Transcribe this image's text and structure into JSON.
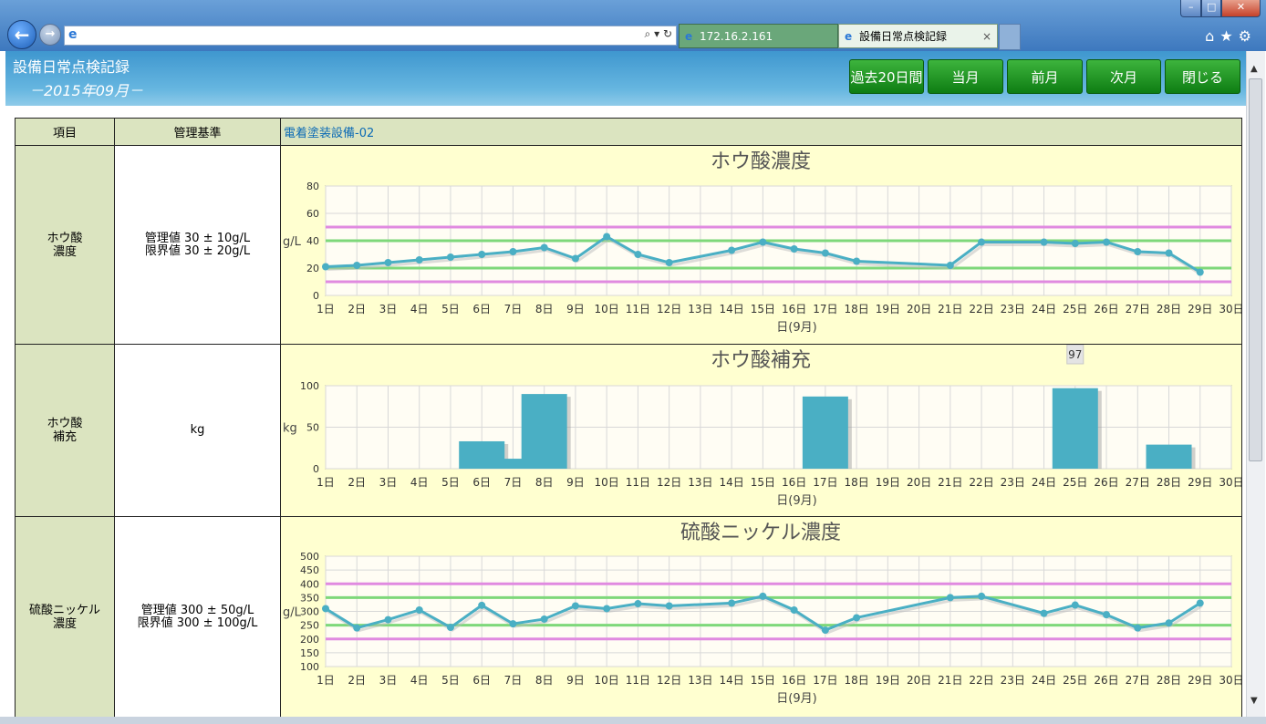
{
  "browser": {
    "tabs": [
      {
        "label": "172.16.2.161"
      },
      {
        "label": "設備日常点検記録"
      }
    ],
    "window_controls": {
      "minimize": "–",
      "maximize": "□",
      "close": "✕"
    }
  },
  "header": {
    "title": "設備日常点検記録",
    "month": "－2015年09月－",
    "buttons": [
      "過去20日間",
      "当月",
      "前月",
      "次月",
      "閉じる"
    ]
  },
  "table": {
    "columns": [
      "項目",
      "管理基準"
    ],
    "equipment": "電着塗装設備-02",
    "rows": [
      {
        "item": [
          "ホウ酸",
          "濃度"
        ],
        "standard": [
          "管理値  30 ± 10g/L",
          "限界値  30 ± 20g/L"
        ]
      },
      {
        "item": [
          "ホウ酸",
          "補充"
        ],
        "standard": [
          "kg"
        ]
      },
      {
        "item": [
          "硫酸ニッケル",
          "濃度"
        ],
        "standard": [
          "管理値  300 ± 50g/L",
          "限界値  300 ± 100g/L"
        ]
      }
    ]
  },
  "colors": {
    "line": "#4aafc4",
    "bar": "#4aafc4",
    "control_limit": "#7ed87a",
    "critical_limit": "#e08ae0",
    "plot_bg": "#fffdf4"
  },
  "chart_data": [
    {
      "type": "line",
      "title": "ホウ酸濃度",
      "ylabel": "g/L",
      "xlabel": "日(9月)",
      "x_ticks": [
        "1日",
        "2日",
        "3日",
        "4日",
        "5日",
        "6日",
        "7日",
        "8日",
        "9日",
        "10日",
        "11日",
        "12日",
        "13日",
        "14日",
        "15日",
        "16日",
        "17日",
        "18日",
        "19日",
        "20日",
        "21日",
        "22日",
        "23日",
        "24日",
        "25日",
        "26日",
        "27日",
        "28日",
        "29日",
        "30日"
      ],
      "ylim": [
        0,
        80
      ],
      "y_ticks": [
        0,
        20,
        40,
        60,
        80
      ],
      "points": [
        [
          1,
          21
        ],
        [
          2,
          22
        ],
        [
          3,
          24
        ],
        [
          4,
          26
        ],
        [
          5,
          28
        ],
        [
          6,
          30
        ],
        [
          7,
          32
        ],
        [
          8,
          35
        ],
        [
          9,
          27
        ],
        [
          10,
          43
        ],
        [
          11,
          30
        ],
        [
          12,
          24
        ],
        [
          14,
          33
        ],
        [
          15,
          39
        ],
        [
          16,
          34
        ],
        [
          17,
          31
        ],
        [
          18,
          25
        ],
        [
          21,
          22
        ],
        [
          22,
          39
        ],
        [
          24,
          39
        ],
        [
          25,
          38
        ],
        [
          26,
          39
        ],
        [
          27,
          32
        ],
        [
          28,
          31
        ],
        [
          29,
          17
        ]
      ],
      "reference_lines": [
        {
          "value": 20,
          "kind": "control"
        },
        {
          "value": 40,
          "kind": "control"
        },
        {
          "value": 10,
          "kind": "critical"
        },
        {
          "value": 50,
          "kind": "critical"
        }
      ]
    },
    {
      "type": "bar",
      "title": "ホウ酸補充",
      "ylabel": "kg",
      "xlabel": "日(9月)",
      "x_ticks": [
        "1日",
        "2日",
        "3日",
        "4日",
        "5日",
        "6日",
        "7日",
        "8日",
        "9日",
        "10日",
        "11日",
        "12日",
        "13日",
        "14日",
        "15日",
        "16日",
        "17日",
        "18日",
        "19日",
        "20日",
        "21日",
        "22日",
        "23日",
        "24日",
        "25日",
        "26日",
        "27日",
        "28日",
        "29日",
        "30日"
      ],
      "ylim": [
        0,
        100
      ],
      "y_ticks": [
        0,
        50,
        100
      ],
      "bars": [
        [
          6,
          33
        ],
        [
          7,
          12
        ],
        [
          8,
          90
        ],
        [
          17,
          87
        ],
        [
          25,
          97
        ],
        [
          28,
          29
        ]
      ],
      "tooltip": {
        "day": 25,
        "value": "97"
      }
    },
    {
      "type": "line",
      "title": "硫酸ニッケル濃度",
      "ylabel": "g/L",
      "xlabel": "日(9月)",
      "x_ticks": [
        "1日",
        "2日",
        "3日",
        "4日",
        "5日",
        "6日",
        "7日",
        "8日",
        "9日",
        "10日",
        "11日",
        "12日",
        "13日",
        "14日",
        "15日",
        "16日",
        "17日",
        "18日",
        "19日",
        "20日",
        "21日",
        "22日",
        "23日",
        "24日",
        "25日",
        "26日",
        "27日",
        "28日",
        "29日",
        "30日"
      ],
      "ylim": [
        100,
        500
      ],
      "y_ticks": [
        100,
        150,
        200,
        250,
        300,
        350,
        400,
        450,
        500
      ],
      "points": [
        [
          1,
          310
        ],
        [
          2,
          240
        ],
        [
          3,
          270
        ],
        [
          4,
          305
        ],
        [
          5,
          242
        ],
        [
          6,
          322
        ],
        [
          7,
          255
        ],
        [
          8,
          272
        ],
        [
          9,
          320
        ],
        [
          10,
          310
        ],
        [
          11,
          328
        ],
        [
          12,
          320
        ],
        [
          14,
          330
        ],
        [
          15,
          355
        ],
        [
          16,
          305
        ],
        [
          17,
          232
        ],
        [
          18,
          277
        ],
        [
          21,
          350
        ],
        [
          22,
          355
        ],
        [
          24,
          293
        ],
        [
          25,
          323
        ],
        [
          26,
          288
        ],
        [
          27,
          240
        ],
        [
          28,
          258
        ],
        [
          29,
          330
        ]
      ],
      "reference_lines": [
        {
          "value": 250,
          "kind": "control"
        },
        {
          "value": 350,
          "kind": "control"
        },
        {
          "value": 200,
          "kind": "critical"
        },
        {
          "value": 400,
          "kind": "critical"
        }
      ]
    }
  ]
}
